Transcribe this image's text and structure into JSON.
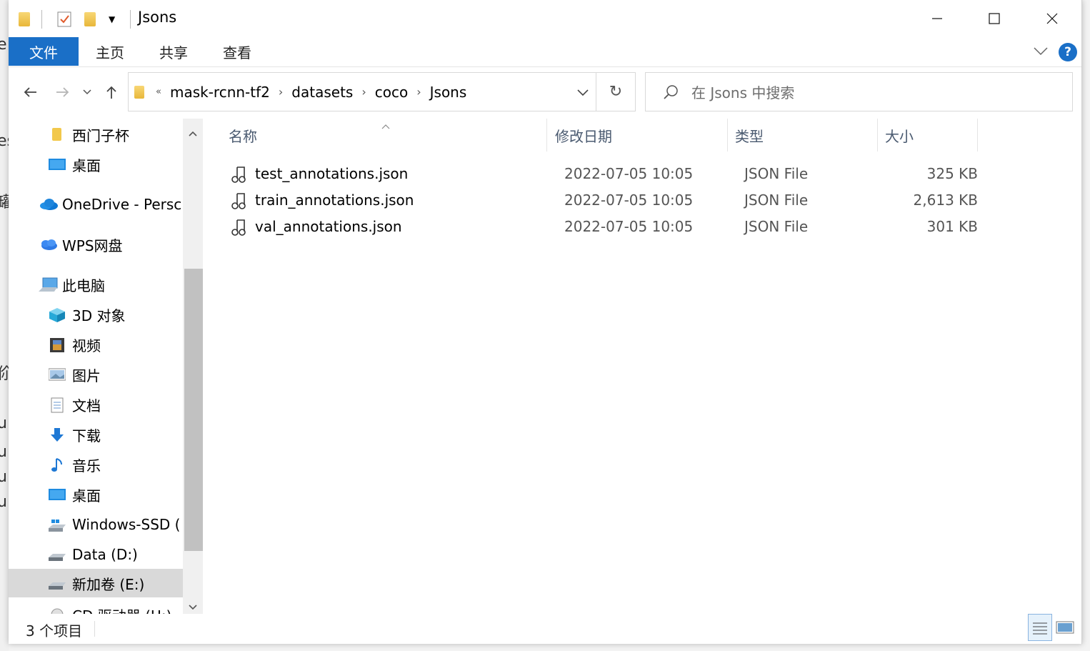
{
  "window": {
    "title": "Jsons"
  },
  "ribbon": {
    "tabs": [
      "文件",
      "主页",
      "共享",
      "查看"
    ]
  },
  "address": {
    "crumbs": [
      "mask-rcnn-tf2",
      "datasets",
      "coco",
      "Jsons"
    ]
  },
  "search": {
    "placeholder": "在 Jsons 中搜索"
  },
  "nav": {
    "items": [
      {
        "label": "西门子杯",
        "icon": "folder-icon"
      },
      {
        "label": "桌面",
        "icon": "desktop-icon"
      },
      {
        "label": "OneDrive - Persc",
        "icon": "onedrive-icon"
      },
      {
        "label": "WPS网盘",
        "icon": "cloud-icon"
      },
      {
        "label": "此电脑",
        "icon": "computer-icon"
      },
      {
        "label": "3D 对象",
        "icon": "3d-objects-icon"
      },
      {
        "label": "视频",
        "icon": "video-icon"
      },
      {
        "label": "图片",
        "icon": "pictures-icon"
      },
      {
        "label": "文档",
        "icon": "documents-icon"
      },
      {
        "label": "下载",
        "icon": "download-icon"
      },
      {
        "label": "音乐",
        "icon": "music-icon"
      },
      {
        "label": "桌面",
        "icon": "desktop-icon"
      },
      {
        "label": "Windows-SSD (",
        "icon": "windows-drive-icon"
      },
      {
        "label": "Data (D:)",
        "icon": "drive-icon"
      },
      {
        "label": "新加卷 (E:)",
        "icon": "drive-icon"
      },
      {
        "label": "CD 驱动器 (H:)",
        "icon": "cd-drive-icon"
      }
    ]
  },
  "list": {
    "columns": [
      "名称",
      "修改日期",
      "类型",
      "大小"
    ],
    "rows": [
      {
        "name": "test_annotations.json",
        "date": "2022-07-05 10:05",
        "type": "JSON File",
        "size": "325 KB"
      },
      {
        "name": "train_annotations.json",
        "date": "2022-07-05 10:05",
        "type": "JSON File",
        "size": "2,613 KB"
      },
      {
        "name": "val_annotations.json",
        "date": "2022-07-05 10:05",
        "type": "JSON File",
        "size": "301 KB"
      }
    ]
  },
  "status": {
    "count": "3 个项目"
  },
  "colors": {
    "accent": "#1a6fc7",
    "selected": "#d9d9d9",
    "help": "#1a6fc7"
  }
}
